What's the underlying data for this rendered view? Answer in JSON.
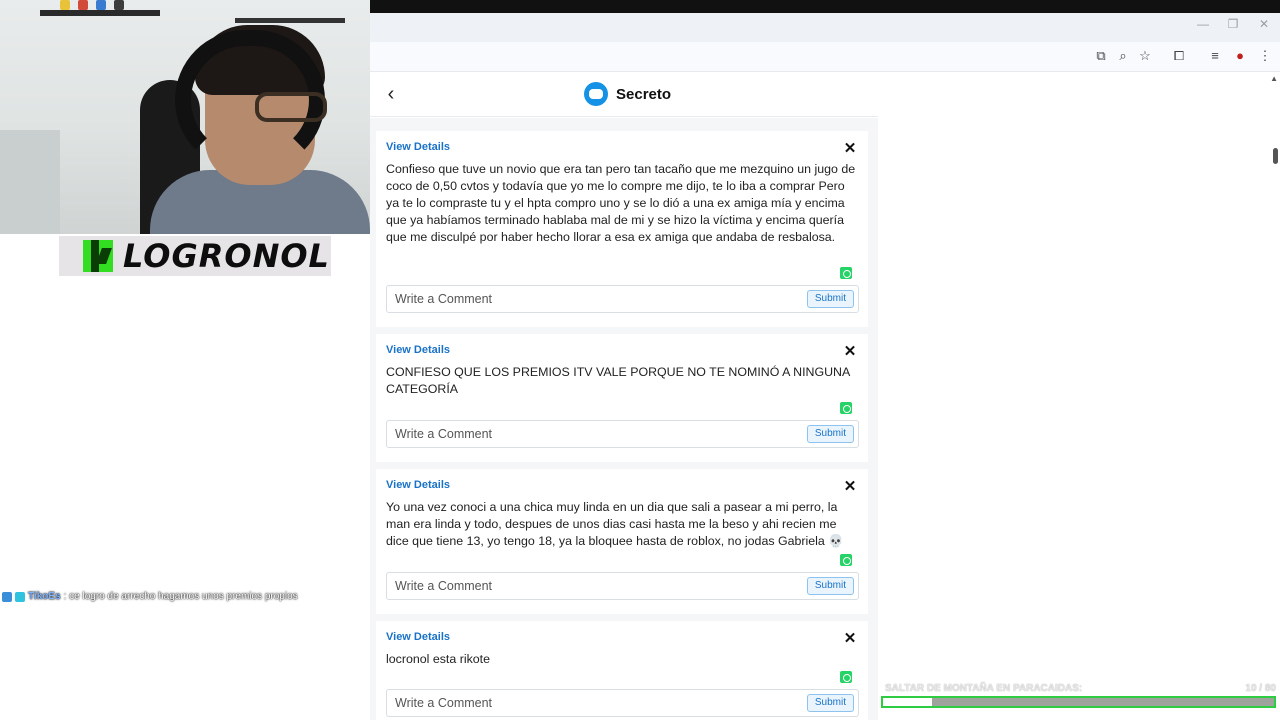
{
  "overlay": {
    "channel_name": "LOGRONOL",
    "chat": {
      "username": "TikoEs",
      "message": ": ce logro de arrecho hagamos unos premios propios"
    },
    "goal": {
      "label": "SALTAR DE MONTAÑA EN PARACAIDAS:",
      "count": "10 / 80",
      "progress_fraction": 0.125,
      "bar_color": "#2ecc40"
    }
  },
  "browser": {
    "window_controls": [
      "—",
      "❐",
      "✕"
    ],
    "toolbar_icons": [
      "install-app-icon",
      "zoom-icon",
      "bookmark-star-icon",
      "extensions-icon",
      "media-icon",
      "profile-icon",
      "menu-icon"
    ]
  },
  "app": {
    "back_icon": "‹",
    "title": "Secreto",
    "accent_color": "#1a73c8",
    "posts": [
      {
        "link": "View Details",
        "text": "Confieso que tuve un novio que era tan pero tan tacaño que me mezquino un jugo de coco de 0,50 cvtos y todavía que yo me lo compre me dijo, te lo iba a comprar Pero ya te lo compraste tu y el hpta compro uno y se lo dió a una ex amiga mía y encima que ya habíamos terminado hablaba mal de mi y se hizo la víctima y encima quería que me disculpé por haber hecho llorar a esa ex amiga que andaba de resbalosa.",
        "comment_placeholder": "Write a Comment",
        "submit": "Submit"
      },
      {
        "link": "View Details",
        "text": "CONFIESO QUE LOS PREMIOS ITV VALE PORQUE NO TE NOMINÓ A NINGUNA CATEGORÍA",
        "comment_placeholder": "Write a Comment",
        "submit": "Submit"
      },
      {
        "link": "View Details",
        "text": "Yo una vez conoci a una chica muy linda en un dia que sali a pasear a mi perro, la man era linda y todo, despues de unos dias casi hasta me la beso y ahi recien me dice que tiene 13, yo tengo 18, ya la bloquee hasta de roblox, no jodas Gabriela 💀",
        "comment_placeholder": "Write a Comment",
        "submit": "Submit"
      },
      {
        "link": "View Details",
        "text": "locronol esta rikote",
        "comment_placeholder": "Write a Comment",
        "submit": "Submit"
      }
    ]
  }
}
